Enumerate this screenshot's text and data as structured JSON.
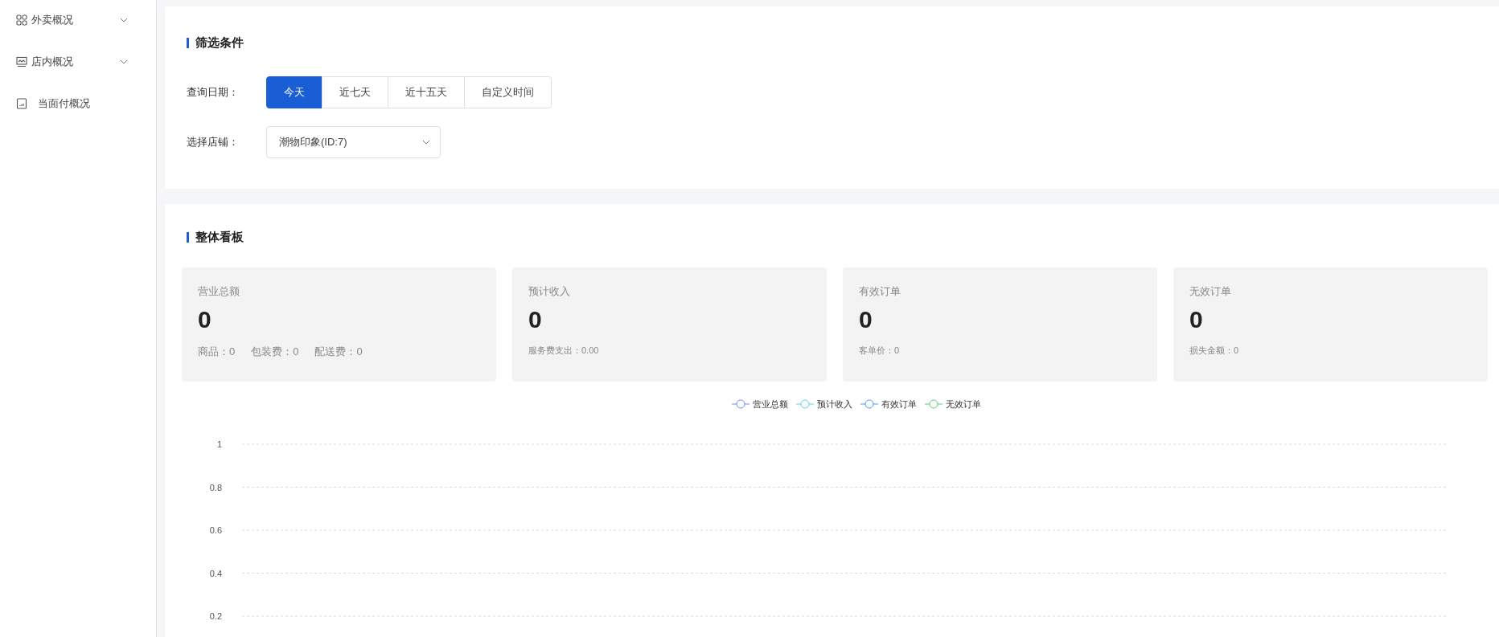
{
  "sidebar": {
    "items": [
      {
        "label": "外卖概况",
        "kind": "grid",
        "expandable": true,
        "selected": false
      },
      {
        "label": "店内概况",
        "kind": "chart",
        "expandable": true,
        "selected": false
      },
      {
        "label": "当面付概况",
        "kind": "receipt",
        "expandable": false,
        "selected": false
      }
    ]
  },
  "filter": {
    "title": "筛选条件",
    "date": {
      "label": "查询日期：",
      "options": [
        {
          "label": "今天",
          "selected": true
        },
        {
          "label": "近七天",
          "selected": false
        },
        {
          "label": "近十五天",
          "selected": false
        },
        {
          "label": "自定义时间",
          "selected": false
        }
      ]
    },
    "store": {
      "label": "选择店铺：",
      "value": "潮物印象(ID:7)"
    }
  },
  "board": {
    "title": "整体看板",
    "cards": [
      {
        "title": "营业总额",
        "value": "0",
        "details": [
          "商品：0",
          "包装费：0",
          "配送费：0"
        ]
      },
      {
        "title": "预计收入",
        "value": "0",
        "details": [
          "服务费支出：0.00"
        ]
      },
      {
        "title": "有效订单",
        "value": "0",
        "details": [
          "客单价：0"
        ]
      },
      {
        "title": "无效订单",
        "value": "0",
        "details": [
          "损失金额：0"
        ]
      }
    ],
    "chart_data": {
      "type": "line",
      "grid": true,
      "ylim": [
        0.2,
        1
      ],
      "yticks": [
        0.2,
        0.4,
        0.6,
        0.8,
        1
      ],
      "series": [
        {
          "name": "营业总额",
          "color": "#6b8ff5"
        },
        {
          "name": "预计收入",
          "color": "#5fd0f2"
        },
        {
          "name": "有效订单",
          "color": "#4b9cf5"
        },
        {
          "name": "无效订单",
          "color": "#5ccf70"
        }
      ]
    }
  }
}
